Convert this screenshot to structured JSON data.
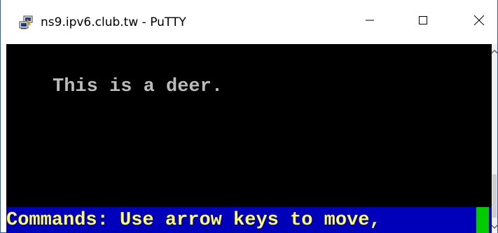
{
  "window": {
    "title": "ns9.ipv6.club.tw - PuTTY",
    "app_icon": "putty-icon",
    "controls": {
      "minimize_icon": "minimize-icon",
      "maximize_icon": "maximize-icon",
      "close_icon": "close-icon"
    }
  },
  "terminal": {
    "lines": [
      "This is a deer."
    ],
    "status_line": "Commands: Use arrow keys to move,",
    "background": "#000000",
    "text_color": "#bbbbbb",
    "status_background": "#0000bb",
    "status_text_color": "#ffff55",
    "cursor_color": "#00cc00"
  },
  "scrollbar": {
    "up_icon": "chevron-up-icon",
    "down_icon": "chevron-down-icon"
  }
}
